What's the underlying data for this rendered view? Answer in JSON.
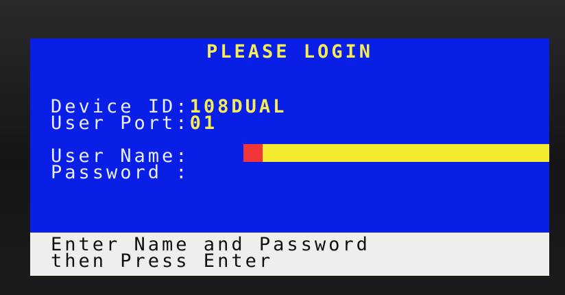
{
  "screen": {
    "title": "PLEASE LOGIN",
    "device": {
      "label": "Device ID:",
      "value": "108DUAL"
    },
    "port": {
      "label": "User Port:",
      "value": "01"
    },
    "username": {
      "label": "User Name:",
      "value": ""
    },
    "password": {
      "label": "Password :",
      "value": ""
    },
    "footer": {
      "line1": "Enter Name and Password",
      "line2": "then Press Enter"
    }
  },
  "colors": {
    "background": "#0a1fe6",
    "highlight_text": "#f6ec57",
    "input_field": "#f4ea2f",
    "cursor": "#f1363a",
    "footer_bar": "#efeeea"
  }
}
